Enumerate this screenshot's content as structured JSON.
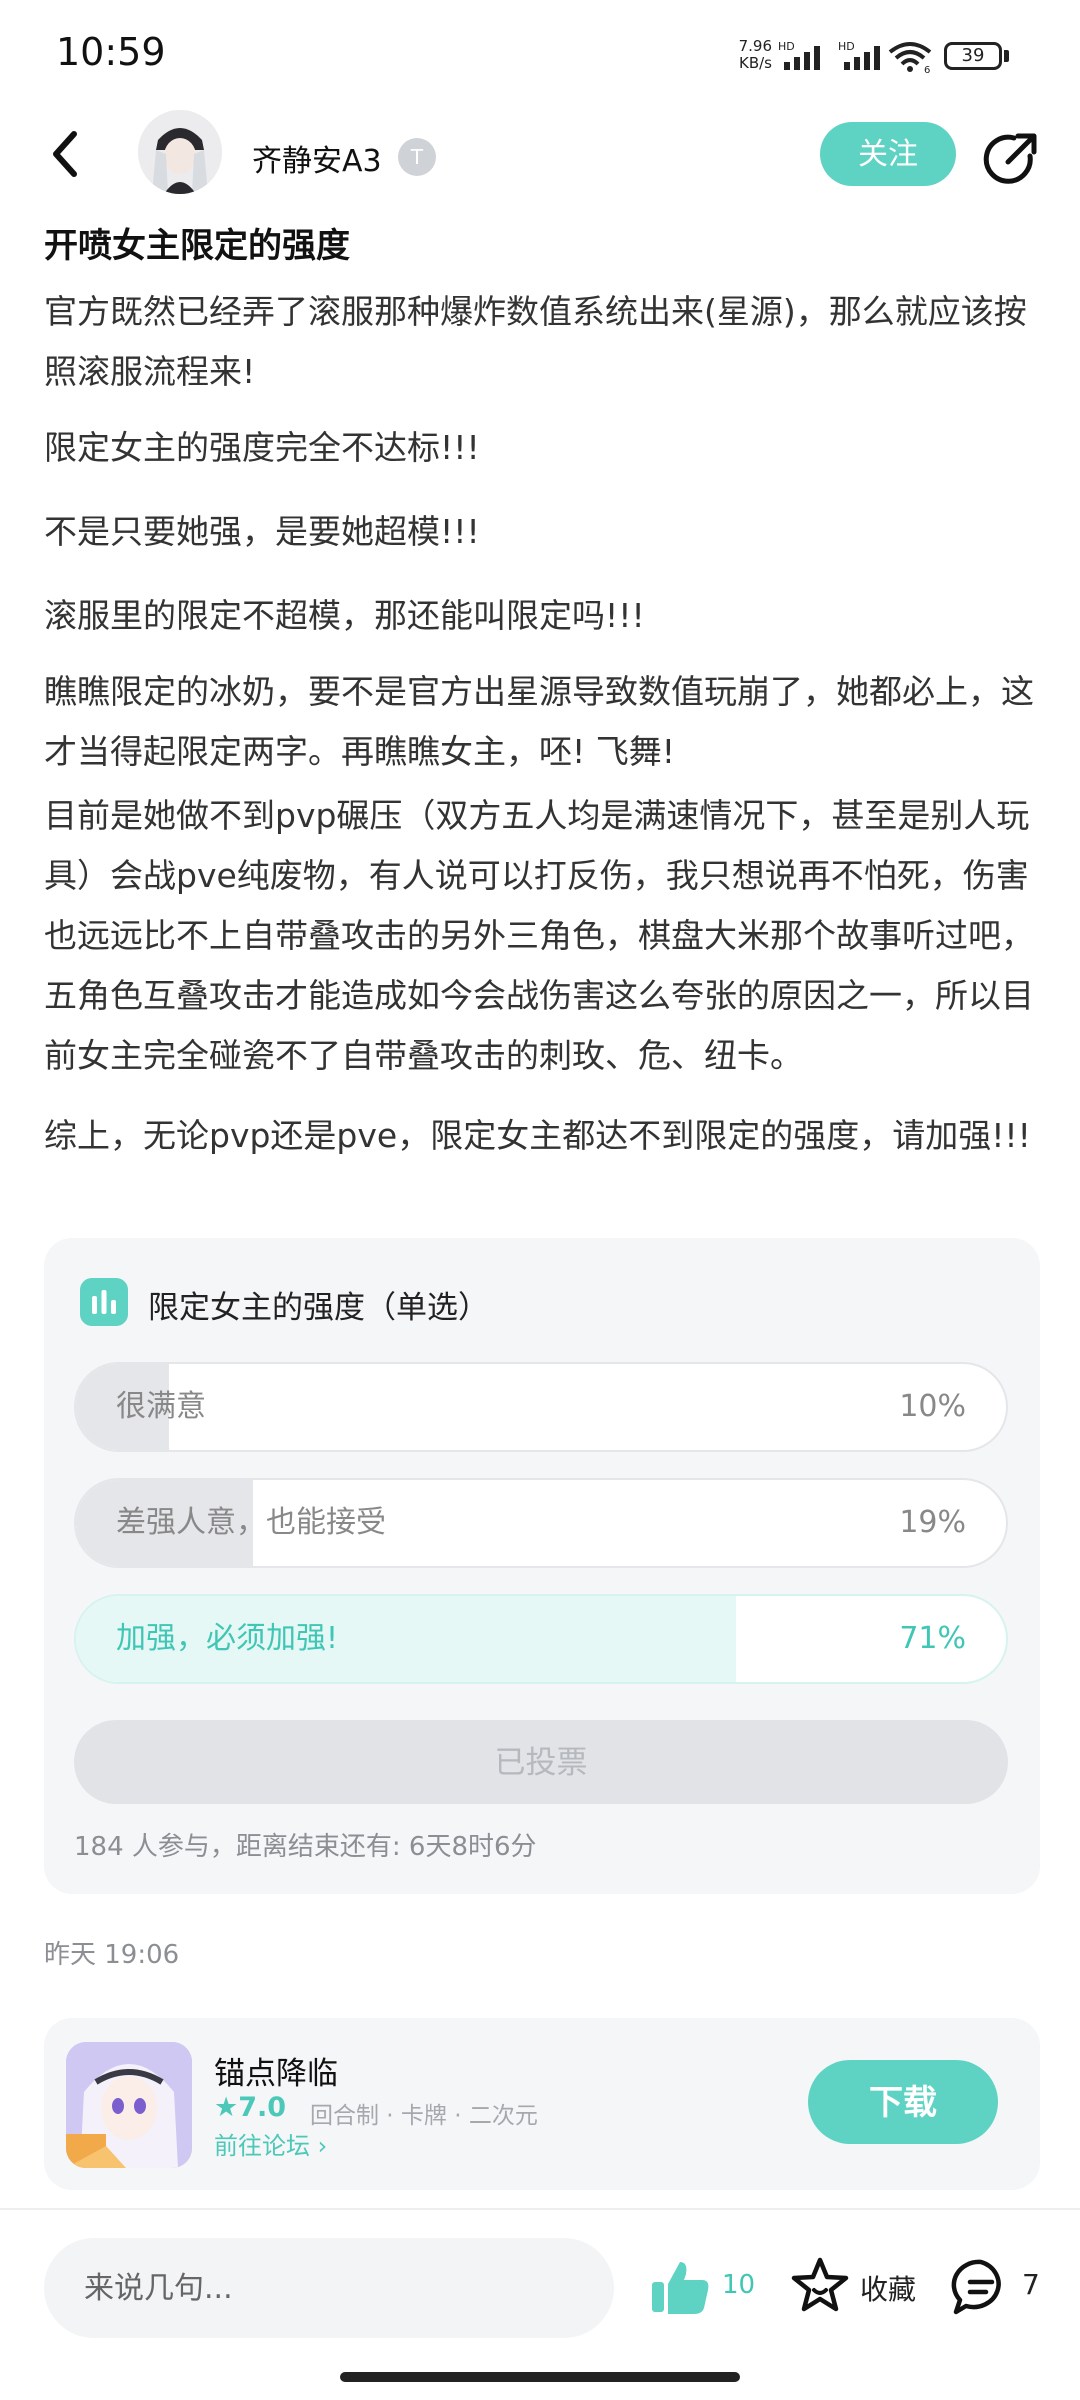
{
  "status_bar": {
    "time": "10:59",
    "net_speed": "7.96",
    "net_unit": "KB/s",
    "hd1": "HD",
    "hd2": "HD",
    "wifi_sub": "6",
    "battery": "39"
  },
  "header": {
    "username": "齐静安A3",
    "badge": "T",
    "follow_label": "关注"
  },
  "post": {
    "title": "开喷女主限定的强度",
    "paragraphs": [
      "官方既然已经弄了滚服那种爆炸数值系统出来(星源)，那么就应该按照滚服流程来!",
      "限定女主的强度完全不达标!!!",
      "不是只要她强，是要她超模!!!",
      "滚服里的限定不超模，那还能叫限定吗!!!",
      "瞧瞧限定的冰奶，要不是官方出星源导致数值玩崩了，她都必上，这才当得起限定两字。再瞧瞧女主，呸! 飞舞!",
      "目前是她做不到pvp碾压（双方五人均是满速情况下，甚至是别人玩具）会战pve纯废物，有人说可以打反伤，我只想说再不怕死，伤害也远远比不上自带叠攻击的另外三角色，棋盘大米那个故事听过吧，五角色互叠攻击才能造成如今会战伤害这么夸张的原因之一，所以目前女主完全碰瓷不了自带叠攻击的刺玫、危、纽卡。",
      "综上，无论pvp还是pve，限定女主都达不到限定的强度，请加强!!!"
    ],
    "time": "昨天 19:06"
  },
  "poll": {
    "title": "限定女主的强度（单选）",
    "options": [
      {
        "label": "很满意",
        "percent_text": "10%",
        "fraction": 0.1
      },
      {
        "label": "差强人意，也能接受",
        "percent_text": "19%",
        "fraction": 0.19
      },
      {
        "label": "加强，必须加强!",
        "percent_text": "71%",
        "fraction": 0.71,
        "selected": true
      }
    ],
    "voted_label": "已投票",
    "footer": "184 人参与，距离结束还有: 6天8时6分"
  },
  "game": {
    "name": "锚点降临",
    "rating": "★7.0",
    "tags": "回合制 · 卡牌 · 二次元",
    "forum_link": "前往论坛 ›",
    "download_label": "下载"
  },
  "bottom_bar": {
    "comment_placeholder": "来说几句...",
    "like_count": "10",
    "favorite_label": "收藏",
    "comment_count": "7"
  },
  "colors": {
    "accent": "#5fd3c3",
    "accent_text": "#3fc6b5",
    "poll_bg": "#f5f6f8"
  }
}
